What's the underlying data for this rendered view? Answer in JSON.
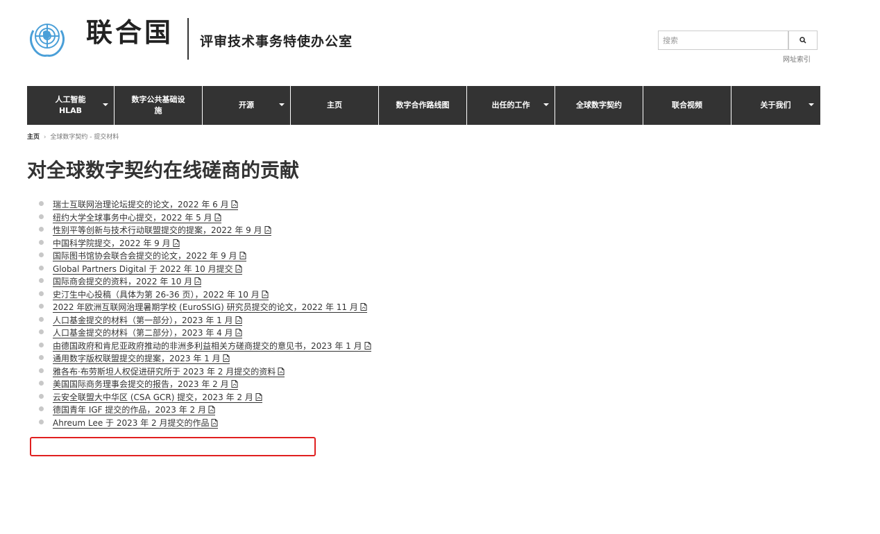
{
  "header": {
    "logo_text": "联合国",
    "office_title": "评审技术事务特使办公室",
    "search_placeholder": "搜索",
    "sitemap_label": "网址索引"
  },
  "nav": {
    "items": [
      {
        "label": "人工智能 HLAB",
        "has_dropdown": true
      },
      {
        "label": "数字公共基础设施",
        "has_dropdown": false
      },
      {
        "label": "开源",
        "has_dropdown": true
      },
      {
        "label": "主页",
        "has_dropdown": false
      },
      {
        "label": "数字合作路线图",
        "has_dropdown": false
      },
      {
        "label": "出任的工作",
        "has_dropdown": true
      },
      {
        "label": "全球数字契约",
        "has_dropdown": false
      },
      {
        "label": "联合视频",
        "has_dropdown": false
      },
      {
        "label": "关于我们",
        "has_dropdown": true
      }
    ]
  },
  "breadcrumb": {
    "home": "主页",
    "separator": "›",
    "current": "全球数字契约 - 提交材料"
  },
  "page_title": "对全球数字契约在线磋商的贡献",
  "documents": [
    "瑞士互联网治理论坛提交的论文，2022 年 6 月",
    "纽约大学全球事务中心提交，2022 年 5 月",
    "性别平等创新与技术行动联盟提交的提案，2022 年 9 月",
    "中国科学院提交，2022 年 9 月",
    "国际图书馆协会联合会提交的论文，2022 年 9 月",
    "Global Partners Digital 于 2022 年 10 月提交",
    "国际商会提交的资料，2022 年 10 月",
    "史汀生中心投稿（具体为第 26-36 页），2022 年 10 月",
    "2022 年欧洲互联网治理暑期学校 (EuroSSIG) 研究员提交的论文，2022 年 11 月",
    "人口基金提交的材料（第一部分），2023 年 1 月",
    "人口基金提交的材料（第二部分），2023 年 4 月",
    "由德国政府和肯尼亚政府推动的非洲多利益相关方磋商提交的意见书，2023 年 1 月",
    "通用数字版权联盟提交的提案，2023 年 1 月",
    "雅各布·布劳斯坦人权促进研究所于 2023 年 2 月提交的资料",
    "美国国际商务理事会提交的报告，2023 年 2 月",
    "云安全联盟大中华区 (CSA GCR) 提交，2023 年 2 月",
    "德国青年 IGF 提交的作品，2023 年 2 月",
    "Ahreum Lee 于 2023 年 2 月提交的作品"
  ],
  "colors": {
    "nav_background": "#333333",
    "highlight": "#e02020",
    "bullet": "#c8c8c8",
    "un_blue": "#4a9fd8"
  }
}
